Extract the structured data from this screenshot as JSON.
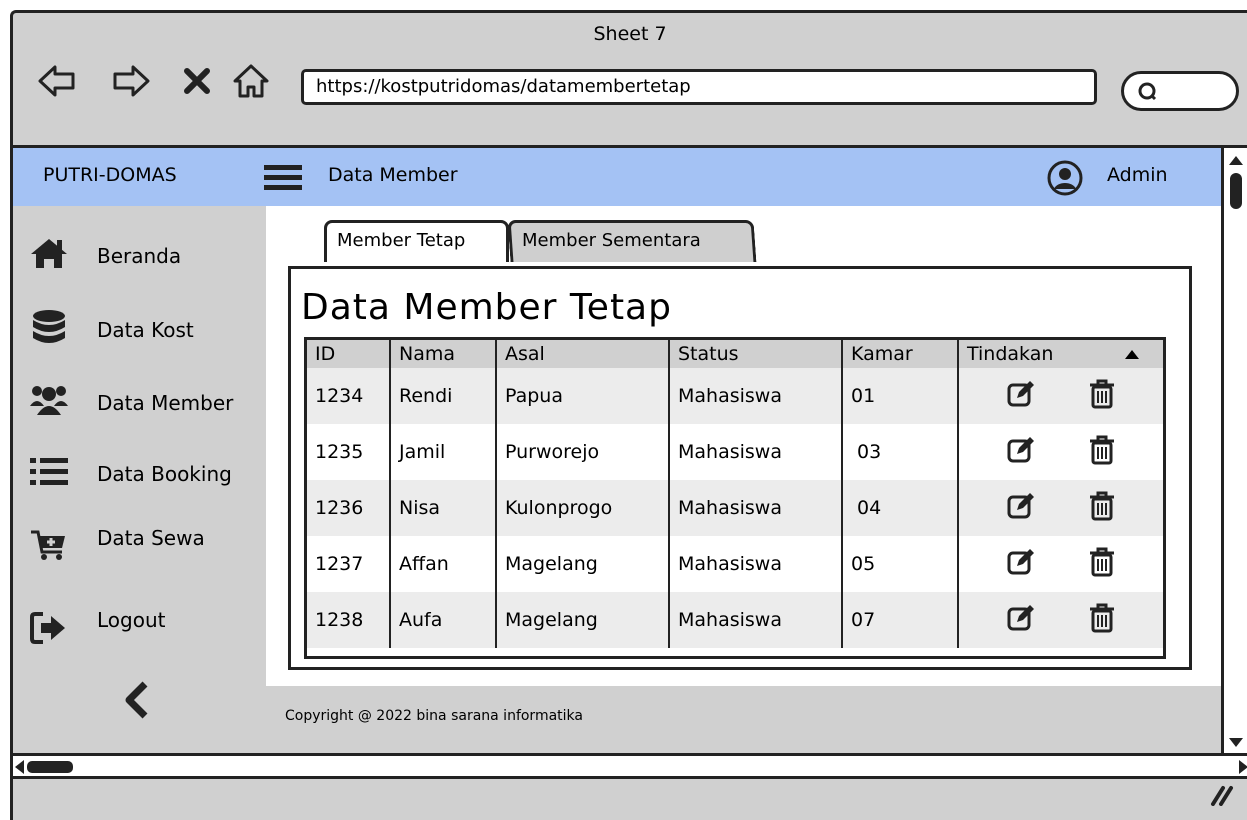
{
  "window": {
    "title": "Sheet 7"
  },
  "browser": {
    "url": "https://kostputridomas/datamembertetap"
  },
  "appbar": {
    "brand": "PUTRI-DOMAS",
    "page_label": "Data Member",
    "user": "Admin"
  },
  "sidebar": {
    "items": [
      {
        "label": "Beranda",
        "icon": "home-icon"
      },
      {
        "label": "Data Kost",
        "icon": "database-icon"
      },
      {
        "label": "Data Member",
        "icon": "users-icon"
      },
      {
        "label": "Data Booking",
        "icon": "list-icon"
      },
      {
        "label": "Data Sewa",
        "icon": "cart-icon"
      },
      {
        "label": "Logout",
        "icon": "logout-icon"
      }
    ]
  },
  "tabs": [
    {
      "label": "Member Tetap"
    },
    {
      "label": "Member Sementara"
    }
  ],
  "panel": {
    "title": "Data Member Tetap"
  },
  "table": {
    "headers": [
      "ID",
      "Nama",
      "Asal",
      "Status",
      "Kamar",
      "Tindakan"
    ],
    "rows": [
      [
        "1234",
        "Rendi",
        "Papua",
        "Mahasiswa",
        "01"
      ],
      [
        "1235",
        "Jamil",
        "Purworejo",
        "Mahasiswa",
        " 03"
      ],
      [
        "1236",
        "Nisa",
        "Kulonprogo",
        "Mahasiswa",
        " 04"
      ],
      [
        "1237",
        "Affan",
        "Magelang",
        "Mahasiswa",
        "05"
      ],
      [
        "1238",
        "Aufa",
        "Magelang",
        "Mahasiswa",
        "07"
      ]
    ]
  },
  "footer": {
    "copyright": "Copyright @ 2022 bina sarana informatika"
  },
  "colors": {
    "appbar": "#a4c2f4",
    "chrome": "#d0d0d0"
  }
}
